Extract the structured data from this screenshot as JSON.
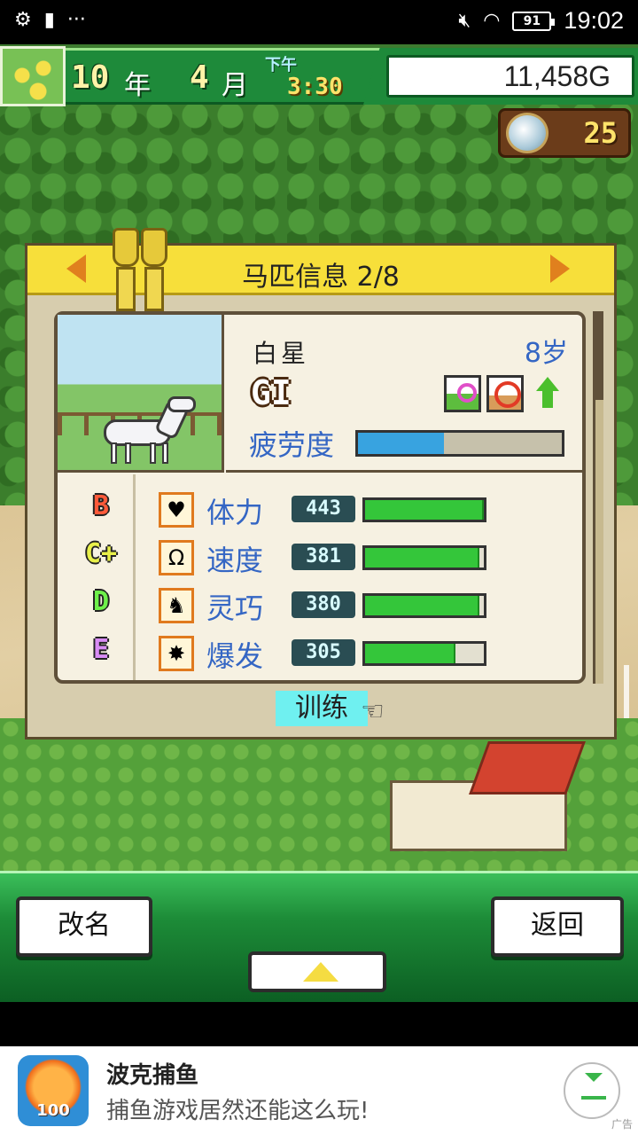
{
  "status_bar": {
    "time": "19:02",
    "battery": "91",
    "icons": [
      "gear-icon",
      "sim-icon",
      "more-icon",
      "mute-icon",
      "wifi-icon",
      "battery-icon"
    ]
  },
  "hud": {
    "year": "10",
    "year_unit": "年",
    "month": "4",
    "month_unit": "月",
    "ampm": "下午",
    "time": "3:30",
    "money": "11,458G",
    "medal_count": "25"
  },
  "panel": {
    "title": "马匹信息 2/8",
    "horse": {
      "name": "白星",
      "age": "8岁",
      "grade": "GI",
      "fatigue_label": "疲劳度",
      "fatigue_level": 0.42
    },
    "stats": [
      {
        "rank": "B",
        "rank_color": "#ff5a3a",
        "icon": "heart-icon",
        "icon_glyph": "♥",
        "label": "体力",
        "value": "443",
        "fill": 1.0
      },
      {
        "rank": "C+",
        "rank_color": "#e8f04a",
        "icon": "horseshoe-icon",
        "icon_glyph": "Ω",
        "label": "速度",
        "value": "381",
        "fill": 0.96
      },
      {
        "rank": "D",
        "rank_color": "#6ef04a",
        "icon": "horse-icon",
        "icon_glyph": "♞",
        "label": "灵巧",
        "value": "380",
        "fill": 0.96
      },
      {
        "rank": "E",
        "rank_color": "#d98cf5",
        "icon": "burst-icon",
        "icon_glyph": "✸",
        "label": "爆发",
        "value": "305",
        "fill": 0.76
      }
    ],
    "train_label": "训练"
  },
  "bottom": {
    "rename_label": "改名",
    "back_label": "返回"
  },
  "ad": {
    "icon_text": "100",
    "title": "波克捕鱼",
    "subtitle": "捕鱼游戏居然还能这么玩!",
    "tag": "广告"
  },
  "colors": {
    "accent_green": "#1e8a3a",
    "panel_header": "#f7df3a",
    "stat_label": "#3466c4",
    "bar_fill": "#34c63a"
  }
}
